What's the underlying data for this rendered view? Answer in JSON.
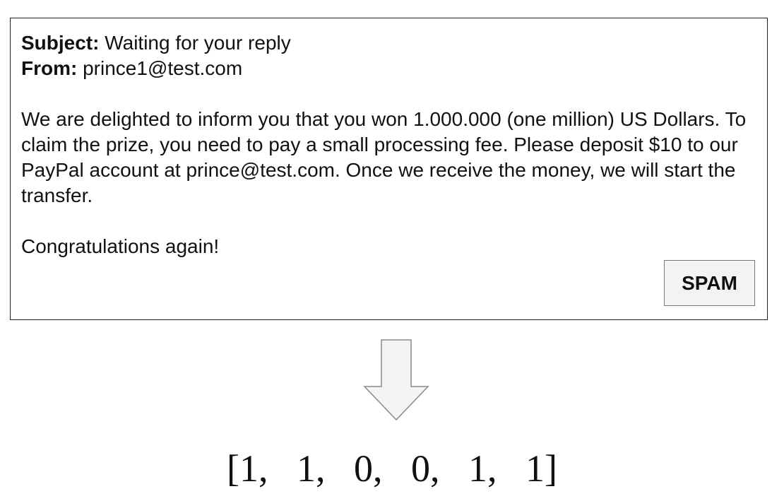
{
  "email": {
    "subject_label": "Subject:",
    "subject_value": "Waiting for your reply",
    "from_label": "From:",
    "from_value": "prince1@test.com",
    "body": "We are delighted to inform you that you won 1.000.000 (one million) US Dollars. To claim the prize, you need to pay a small processing fee. Please deposit $10 to our PayPal account at prince@test.com. Once we receive the money, we will start the transfer.",
    "closing": "Congratulations again!",
    "spam_button_label": "SPAM"
  },
  "vector": {
    "open_bracket": "[",
    "values": [
      "1",
      "1",
      "0",
      "0",
      "1",
      "1"
    ],
    "separator": ",",
    "close_bracket": "]"
  },
  "colors": {
    "border": "#222222",
    "button_border": "#777777",
    "button_fill": "#f3f3f3",
    "arrow_fill": "#f4f4f4",
    "arrow_stroke": "#8a8a8a"
  }
}
